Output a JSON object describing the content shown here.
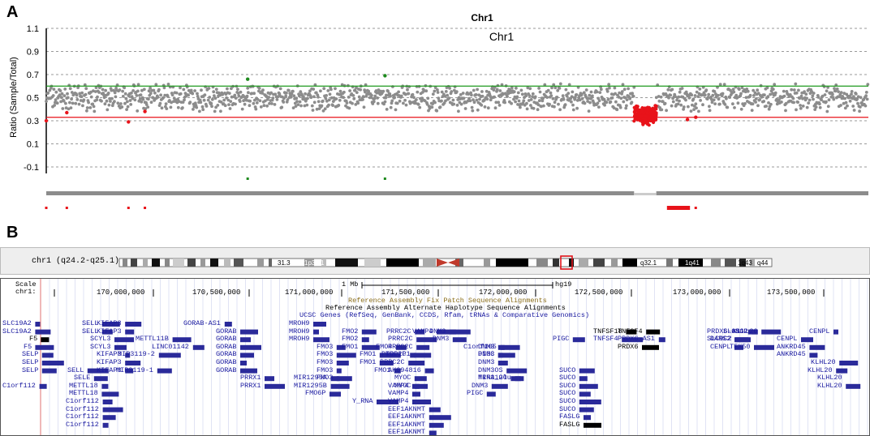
{
  "panels": {
    "a": "A",
    "b": "B"
  },
  "chart_data": {
    "type": "scatter",
    "title": "Chr1",
    "subtitle": "Chr1",
    "ylabel": "Ratio (Sample/Total)",
    "ylim": [
      -0.1,
      1.1
    ],
    "yticks": [
      "1.1",
      "0.9",
      "0.7",
      "0.5",
      "0.3",
      "0.1",
      "-0.1"
    ],
    "grid": true,
    "thresholds": {
      "upper": 0.6,
      "lower": 0.33
    },
    "colors": {
      "normal": "#8c8c8c",
      "loss": "#e8131a",
      "gain": "#1e8a1e",
      "upper_line": "#1e9a1e",
      "lower_line": "#e8131a"
    },
    "series": [
      {
        "values_range": [
          0.38,
          0.62
        ]
      },
      {
        "x_range_frac": [
          0.715,
          0.742
        ],
        "values_range": [
          0.26,
          0.44
        ]
      }
    ],
    "gain_points": [
      [
        0.245,
        0.66
      ],
      [
        0.412,
        0.69
      ]
    ],
    "loss_points": [
      [
        0.0,
        0.3
      ],
      [
        0.025,
        0.37
      ],
      [
        0.1,
        0.29
      ],
      [
        0.12,
        0.38
      ],
      [
        0.78,
        0.31
      ],
      [
        0.79,
        0.33
      ]
    ]
  },
  "browser": {
    "ideogram_label": "chr1 (q24.2-q25.1)",
    "bands": [
      "33",
      "31.3",
      "1p31.1",
      "1q12",
      "q32.1",
      "1q41",
      "1q43",
      "q44"
    ],
    "scale_label": "Scale",
    "chr_label": "chr1:",
    "scale_bar_label": "1 Mb",
    "assembly": "hg19",
    "ruler": [
      "170,000,000",
      "170,500,000",
      "171,000,000",
      "171,500,000",
      "172,000,000",
      "172,500,000",
      "173,000,000",
      "173,500,000"
    ],
    "track_titles": [
      "Reference Assembly Fix Patch Sequence Alignments",
      "Reference Assembly Alternate Haplotype Sequence Alignments",
      "UCSC Genes (RefSeq, GenBank, CCDS, Rfam, tRNAs & Comparative Genomics)"
    ],
    "genes": [
      "SLC19A2",
      "SLC19A2",
      "F5",
      "F5",
      "SELP",
      "SELP",
      "SELP",
      "C1orf112",
      "SELL",
      "SELL",
      "SELL",
      "SELE",
      "METTL18",
      "METTL18",
      "C1orf112",
      "C1orf112",
      "C1orf112",
      "C1orf112",
      "KIFAP3",
      "KIFAP3",
      "SCYL3",
      "SCYL3",
      "KIFAP3",
      "KIFAP3",
      "KIFAP3",
      "METTL11B",
      "LINC01142",
      "MIR3119-2",
      "MIR3119-1",
      "GORAB-AS1",
      "GORAB",
      "GORAB",
      "GORAB",
      "GORAB",
      "GORAB",
      "GORAB",
      "PRRX1",
      "PRRX1",
      "MROH9",
      "MROH9",
      "MROH9",
      "FMO3",
      "FMO3",
      "FMO3",
      "FMO3",
      "FMO3",
      "MIR1295A",
      "MIR1295B",
      "FMO6P",
      "Y_RNA",
      "FMO2",
      "FMO2",
      "FMO1",
      "FMO4",
      "FMO1",
      "FMO1",
      "FMO1",
      "TOP1P1",
      "PRRC2C",
      "PRRC2C",
      "PRRC2C",
      "PRRC2C",
      "PRRC2C",
      "AK094816",
      "VAMP4",
      "MYOC",
      "MYOC",
      "VAMP4",
      "VAMP4",
      "VAMP4",
      "EEF1AKNMT",
      "EEF1AKNMT",
      "EEF1AKNMT",
      "EEF1AKNMT",
      "7SK",
      "MIR214",
      "DNM3",
      "DNM3",
      "DNM3",
      "DNM3",
      "DNM3",
      "DNM3OS",
      "MIR3120",
      "TRNA_Glu",
      "DNM3",
      "PIGC",
      "C1orf105",
      "PIGC",
      "PIGC",
      "SUCO",
      "SUCO",
      "SUCO",
      "SUCO",
      "SUCO",
      "SUCO",
      "FASLG",
      "FASLG",
      "TNFSF18",
      "TNFSF4",
      "TNFSF4",
      "PRDX6-AS1",
      "PRDX6",
      "PRDX6-AS1",
      "TEX50",
      "SLC9C2",
      "SLC9C2",
      "DARS2",
      "CENPL",
      "KLHL20",
      "CENPL",
      "CENPL",
      "ANKRD45",
      "ANKRD45",
      "KLHL20",
      "KLHL20",
      "KLHL20",
      "KLHL20"
    ]
  }
}
